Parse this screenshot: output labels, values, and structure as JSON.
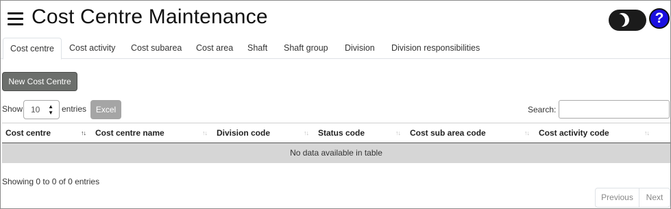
{
  "header": {
    "title": "Cost Centre Maintenance",
    "menu_icon": "hamburger-menu-icon",
    "theme_toggle_icon": "moon-icon",
    "help_label": "?"
  },
  "tabs": [
    {
      "label": "Cost centre",
      "active": true
    },
    {
      "label": "Cost activity",
      "active": false
    },
    {
      "label": "Cost subarea",
      "active": false
    },
    {
      "label": "Cost area",
      "active": false
    },
    {
      "label": "Shaft",
      "active": false
    },
    {
      "label": "Shaft group",
      "active": false
    },
    {
      "label": "Division",
      "active": false
    },
    {
      "label": "Division responsibilities",
      "active": false
    }
  ],
  "toolbar": {
    "new_button_label": "New Cost Centre",
    "show_label": "Show",
    "entries_value": "10",
    "entries_label": "entries",
    "excel_label": "Excel",
    "search_label": "Search:",
    "search_value": ""
  },
  "table": {
    "columns": [
      {
        "label": "Cost centre",
        "sorted": true
      },
      {
        "label": "Cost centre name",
        "sorted": false
      },
      {
        "label": "Division code",
        "sorted": false
      },
      {
        "label": "Status code",
        "sorted": false
      },
      {
        "label": "Cost sub area code",
        "sorted": false
      },
      {
        "label": "Cost activity code",
        "sorted": false
      }
    ],
    "empty_message": "No data available in table"
  },
  "footer": {
    "info": "Showing 0 to 0 of 0 entries",
    "previous_label": "Previous",
    "next_label": "Next"
  },
  "colors": {
    "help_button": "#1a0fe0",
    "new_button": "#6c6f6c",
    "excel_button": "#a5a5a5",
    "empty_row": "#d6d6d6"
  }
}
